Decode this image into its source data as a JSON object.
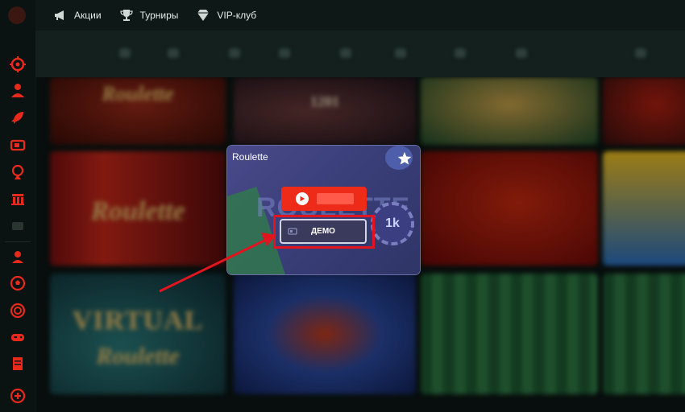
{
  "nav": {
    "items": [
      {
        "label": "Акции",
        "icon": "megaphone-icon"
      },
      {
        "label": "Турниры",
        "icon": "trophy-icon"
      },
      {
        "label": "VIP-клуб",
        "icon": "diamond-icon"
      }
    ]
  },
  "sidebar": {
    "icons": [
      "roulette-icon",
      "user-icon",
      "rocket-icon",
      "tv-icon",
      "wheel-icon",
      "building-icon",
      "ticket-icon",
      "dealer-icon",
      "football-icon",
      "target-icon",
      "gamepad-icon",
      "receipt-icon",
      "plus-circle-icon"
    ]
  },
  "grid": {
    "tiles": [
      {
        "text": "Roulette"
      },
      {
        "text": "1201"
      },
      {
        "text": ""
      },
      {
        "text": ""
      },
      {
        "text": "Roulette"
      },
      {
        "text": ""
      },
      {
        "text": ""
      },
      {
        "text": "VIRTUAL"
      },
      {
        "text": "Roulette"
      },
      {
        "text": ""
      },
      {
        "text": ""
      },
      {
        "text": ""
      }
    ]
  },
  "card": {
    "title": "Roulette",
    "demo_label": "ДЕМО",
    "chip_label": "1k"
  },
  "colors": {
    "accent_red": "#ee2a18",
    "highlight_red": "#e0151f",
    "sidebar_icon": "#e8291b"
  }
}
